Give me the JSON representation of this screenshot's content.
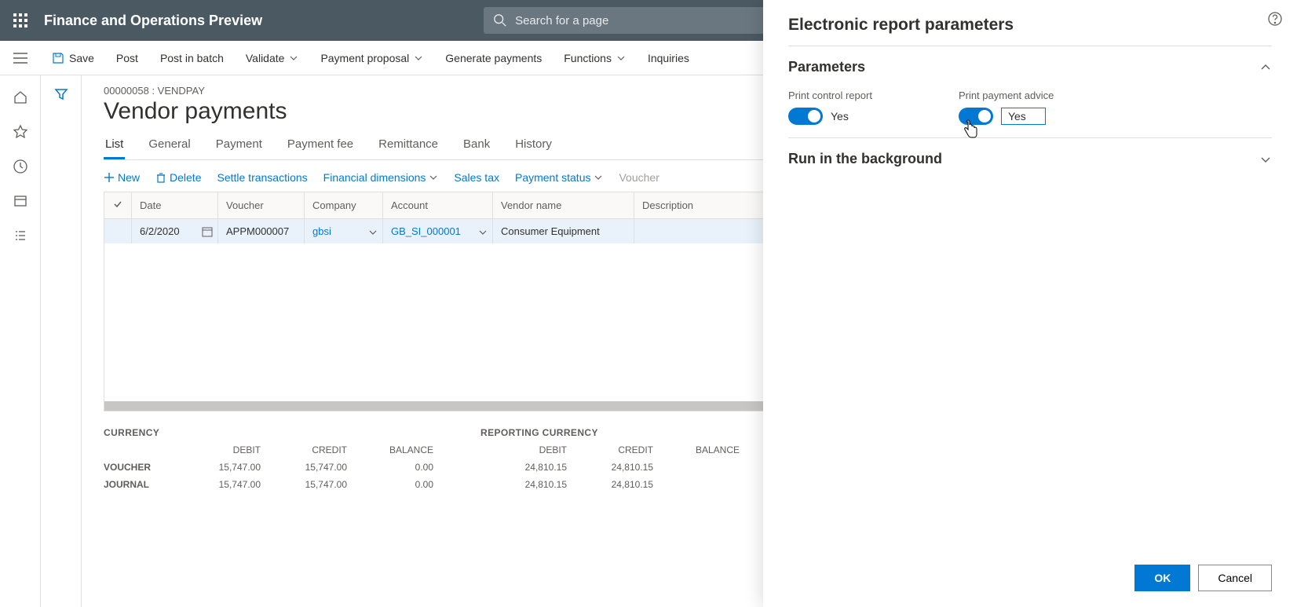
{
  "app_title": "Finance and Operations Preview",
  "search_placeholder": "Search for a page",
  "commands": {
    "save": "Save",
    "post": "Post",
    "post_batch": "Post in batch",
    "validate": "Validate",
    "payment_proposal": "Payment proposal",
    "generate_payments": "Generate payments",
    "functions": "Functions",
    "inquiries": "Inquiries"
  },
  "breadcrumb": "00000058 : VENDPAY",
  "page_title": "Vendor payments",
  "tabs": [
    "List",
    "General",
    "Payment",
    "Payment fee",
    "Remittance",
    "Bank",
    "History"
  ],
  "grid_actions": {
    "new": "New",
    "delete": "Delete",
    "settle": "Settle transactions",
    "fin_dim": "Financial dimensions",
    "sales_tax": "Sales tax",
    "payment_status": "Payment status",
    "voucher": "Voucher"
  },
  "grid": {
    "headers": [
      "Date",
      "Voucher",
      "Company",
      "Account",
      "Vendor name",
      "Description"
    ],
    "row": {
      "date": "6/2/2020",
      "voucher": "APPM000007",
      "company": "gbsi",
      "account": "GB_SI_000001",
      "vendor_name": "Consumer Equipment",
      "description": ""
    }
  },
  "footer": {
    "currency_label": "CURRENCY",
    "reporting_label": "REPORTING CURRENCY",
    "cols": [
      "DEBIT",
      "CREDIT",
      "BALANCE"
    ],
    "rows": [
      "VOUCHER",
      "JOURNAL"
    ],
    "currency_vals": {
      "voucher": [
        "15,747.00",
        "15,747.00",
        "0.00"
      ],
      "journal": [
        "15,747.00",
        "15,747.00",
        "0.00"
      ]
    },
    "reporting_vals": {
      "voucher": [
        "24,810.15",
        "24,810.15"
      ],
      "journal": [
        "24,810.15",
        "24,810.15"
      ]
    }
  },
  "panel": {
    "title": "Electronic report parameters",
    "parameters_section": "Parameters",
    "run_bg_section": "Run in the background",
    "print_control": {
      "label": "Print control report",
      "value": "Yes"
    },
    "print_advice": {
      "label": "Print payment advice",
      "value": "Yes"
    },
    "ok": "OK",
    "cancel": "Cancel"
  }
}
